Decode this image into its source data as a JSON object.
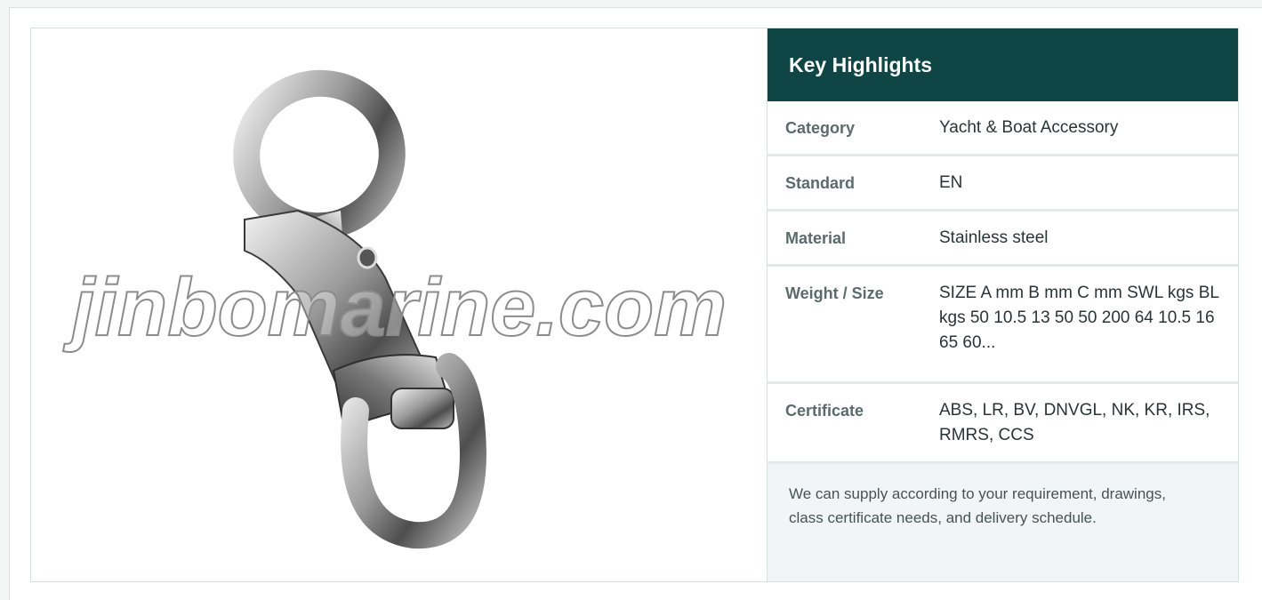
{
  "product_image": {
    "alt": "Stainless steel swivel snap hook",
    "watermark": "jinbomarine.com"
  },
  "highlights": {
    "title": "Key Highlights",
    "rows": [
      {
        "key": "Category",
        "value": "Yacht & Boat Accessory"
      },
      {
        "key": "Standard",
        "value": "EN"
      },
      {
        "key": "Material",
        "value": "Stainless steel"
      },
      {
        "key": "Weight / Size",
        "value": "SIZE A mm B mm C mm SWL kgs BL kgs 50 10.5 13 50 50 200 64 10.5 16 65 60..."
      },
      {
        "key": "Certificate",
        "value": "ABS, LR, BV, DNVGL, NK, KR, IRS, RMRS, CCS"
      }
    ],
    "note": "We can supply according to your requirement, drawings, class certificate needs, and delivery schedule."
  },
  "colors": {
    "header_bg": "#0f4645",
    "note_bg": "#f2f5f5",
    "border": "#d6e0df"
  }
}
